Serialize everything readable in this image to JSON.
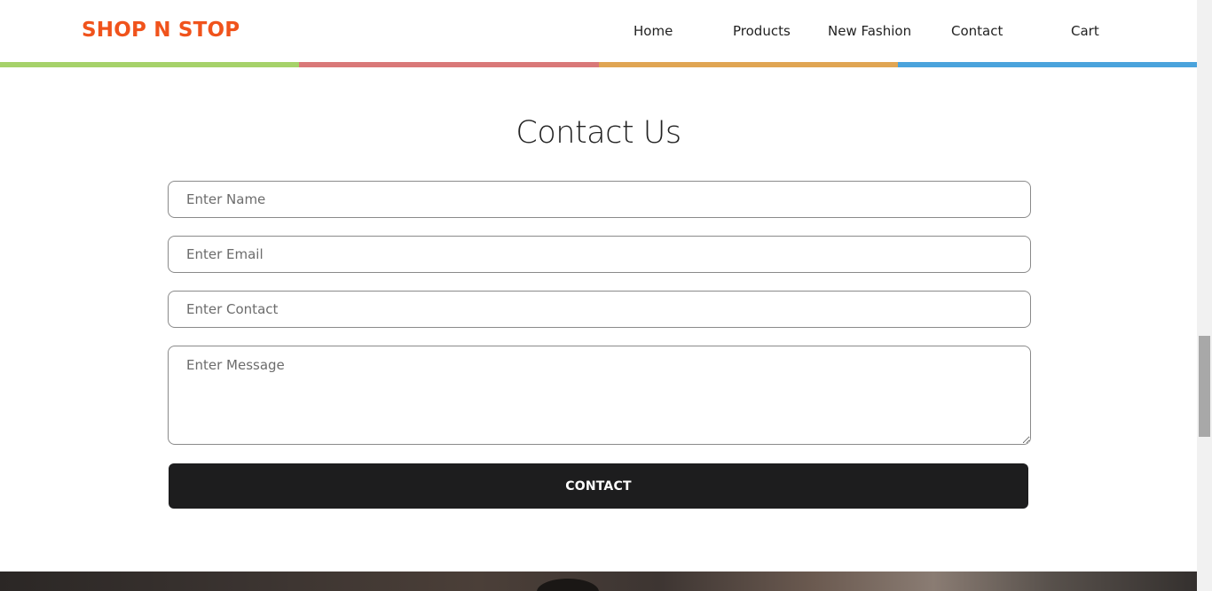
{
  "brand": {
    "logo": "SHOP N STOP"
  },
  "nav": {
    "home": "Home",
    "products": "Products",
    "new_fashion": "New Fashion",
    "contact": "Contact",
    "cart": "Cart"
  },
  "colors": {
    "brand": "#f0531c",
    "stripe_green": "#a6d26a",
    "stripe_red": "#d97878",
    "stripe_orange": "#e0a553",
    "stripe_blue": "#4aa3dc",
    "button": "#1d1d1e"
  },
  "contact": {
    "title": "Contact Us",
    "name_placeholder": "Enter Name",
    "email_placeholder": "Enter Email",
    "contact_placeholder": "Enter Contact",
    "message_placeholder": "Enter Message",
    "submit_label": "CONTACT"
  }
}
